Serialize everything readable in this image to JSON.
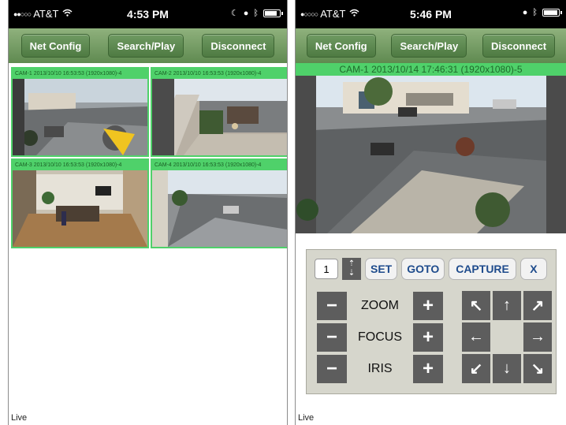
{
  "left": {
    "status": {
      "carrier": "AT&T",
      "time": "4:53 PM"
    },
    "toolbar": {
      "net_config": "Net Config",
      "search_play": "Search/Play",
      "disconnect": "Disconnect"
    },
    "cameras": [
      {
        "label": "CAM-1 2013/10/10 16:53:53 (1920x1080)-4"
      },
      {
        "label": "CAM-2 2013/10/10 16:53:53 (1920x1080)-4"
      },
      {
        "label": "CAM-3 2013/10/10 16:53:53 (1920x1080)-4"
      },
      {
        "label": "CAM-4 2013/10/10 16:53:53 (1920x1080)-4"
      }
    ],
    "footer": "Live"
  },
  "right": {
    "status": {
      "carrier": "AT&T",
      "time": "5:46 PM"
    },
    "toolbar": {
      "net_config": "Net Config",
      "search_play": "Search/Play",
      "disconnect": "Disconnect"
    },
    "camera_label": "CAM-1 2013/10/14 17:46:31 (1920x1080)-5",
    "ptz": {
      "preset_value": "1",
      "set": "SET",
      "goto": "GOTO",
      "capture": "CAPTURE",
      "close": "X",
      "zoom": "ZOOM",
      "focus": "FOCUS",
      "iris": "IRIS",
      "minus": "−",
      "plus": "+",
      "arrows": [
        "↖",
        "↑",
        "↗",
        "←",
        "→",
        "↙",
        "↓",
        "↘"
      ]
    },
    "footer": "Live"
  },
  "colors": {
    "toolbar_top": "#8fb17d",
    "toolbar_bottom": "#5f8a50",
    "cam_label_bg": "#4fd16a",
    "button_text": "#1e4b8c"
  },
  "icons": [
    "wifi-icon",
    "battery-icon",
    "moon-icon",
    "lock-icon",
    "bluetooth-icon",
    "pointer-arrow-icon"
  ]
}
